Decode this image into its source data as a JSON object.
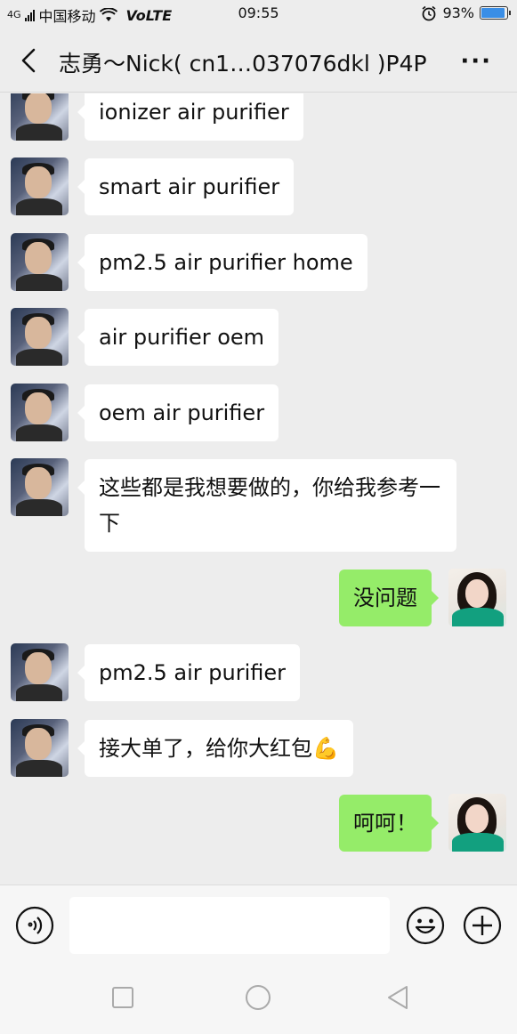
{
  "status_bar": {
    "signal_label": "4G",
    "carrier": "中国移动",
    "volte": "VoLTE",
    "time": "09:55",
    "battery_percent": "93%",
    "battery_level": 0.93
  },
  "header": {
    "title": "志勇～Nick( cn1…037076dkl )P4P",
    "more": "···"
  },
  "messages": [
    {
      "from": "him",
      "text": "ionizer air purifier"
    },
    {
      "from": "him",
      "text": "smart air purifier"
    },
    {
      "from": "him",
      "text": "pm2.5 air purifier home"
    },
    {
      "from": "him",
      "text": "air purifier oem"
    },
    {
      "from": "him",
      "text": "oem air purifier"
    },
    {
      "from": "him",
      "text": "这些都是我想要做的，你给我参考一下"
    },
    {
      "from": "me",
      "text": "没问题"
    },
    {
      "from": "him",
      "text": "pm2.5 air purifier"
    },
    {
      "from": "him",
      "text": "接大单了，给你大红包💪"
    },
    {
      "from": "me",
      "text": "呵呵！"
    }
  ],
  "input": {
    "value": "",
    "placeholder": ""
  },
  "icons": {
    "back": "chevron-left-icon",
    "more": "more-dots-icon",
    "voice": "voice-icon",
    "emoji": "emoji-icon",
    "plus": "plus-icon",
    "nav_recent": "square-icon",
    "nav_home": "circle-icon",
    "nav_back": "triangle-back-icon"
  },
  "colors": {
    "background": "#ededed",
    "incoming_bubble": "#ffffff",
    "outgoing_bubble": "#95ec69",
    "battery": "#3a8ee6"
  }
}
